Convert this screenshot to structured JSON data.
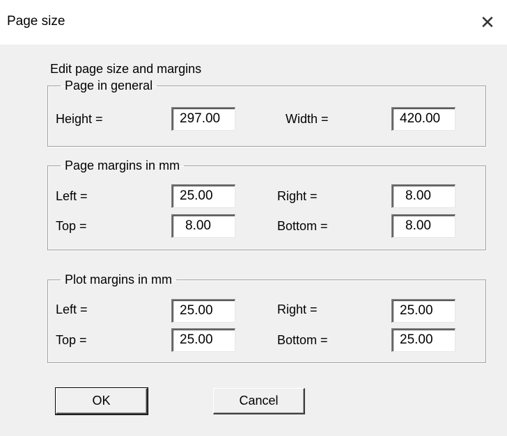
{
  "window": {
    "title": "Page size"
  },
  "heading": "Edit page size and margins",
  "page_general": {
    "legend": "Page in general",
    "height_label": "Height =",
    "height_value": "297.00",
    "width_label": "Width =",
    "width_value": "420.00"
  },
  "page_margins": {
    "legend": "Page margins in mm",
    "left_label": "Left =",
    "left_value": "25.00",
    "right_label": "Right =",
    "right_value": "8.00",
    "top_label": "Top =",
    "top_value": "8.00",
    "bottom_label": "Bottom =",
    "bottom_value": "8.00"
  },
  "plot_margins": {
    "legend": "Plot margins in mm",
    "left_label": "Left =",
    "left_value": "25.00",
    "right_label": "Right =",
    "right_value": "25.00",
    "top_label": "Top =",
    "top_value": "25.00",
    "bottom_label": "Bottom =",
    "bottom_value": "25.00"
  },
  "buttons": {
    "ok": "OK",
    "cancel": "Cancel"
  },
  "icons": {
    "close": "close-icon"
  }
}
